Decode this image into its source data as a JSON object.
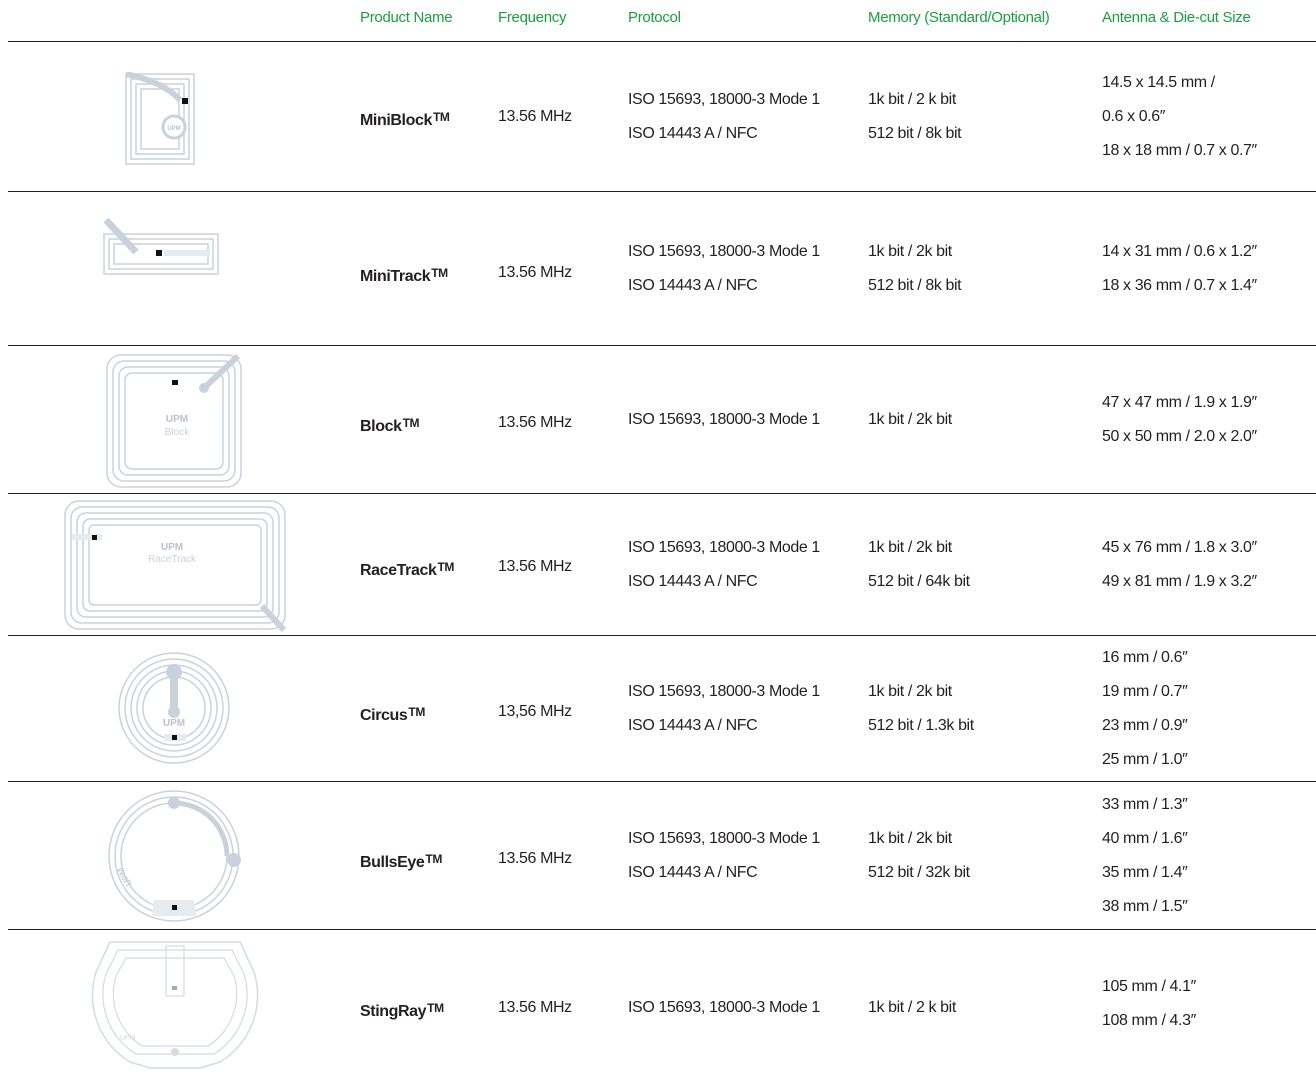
{
  "headers": {
    "product_name": "Product Name",
    "frequency": "Frequency",
    "protocol": "Protocol",
    "memory": "Memory (Standard/Optional)",
    "antenna": "Antenna & Die-cut Size"
  },
  "colors": {
    "header_text": "#1a9e3f",
    "rule": "#231f20",
    "antenna": "#c9d2da"
  },
  "rows": [
    {
      "name": "MiniBlock",
      "tm": "TM",
      "frequency": "13.56 MHz",
      "protocol": [
        "ISO 15693, 18000-3 Mode 1",
        "ISO 14443 A / NFC"
      ],
      "memory": [
        "1k bit / 2 k bit",
        "512 bit / 8k bit"
      ],
      "antenna": [
        "14.5 x 14.5 mm /",
        "0.6 x 0.6″",
        "18 x 18 mm / 0.7 x 0.7″"
      ],
      "image_logo": "UPM"
    },
    {
      "name": "MiniTrack",
      "tm": "TM",
      "frequency": "13.56 MHz",
      "protocol": [
        "ISO 15693, 18000-3 Mode 1",
        "ISO 14443 A / NFC"
      ],
      "memory": [
        "1k bit / 2k bit",
        "512 bit / 8k bit"
      ],
      "antenna": [
        "14 x 31 mm / 0.6 x 1.2″",
        "18 x 36 mm / 0.7 x 1.4″"
      ],
      "image_logo": ""
    },
    {
      "name": "Block",
      "tm": "TM",
      "frequency": "13.56 MHz",
      "protocol": [
        "ISO 15693, 18000-3 Mode 1"
      ],
      "memory": [
        "1k bit / 2k bit"
      ],
      "antenna": [
        "47 x 47 mm / 1.9 x 1.9″",
        "50 x 50 mm / 2.0 x 2.0″"
      ],
      "image_logo": "UPM",
      "image_caption": "Block"
    },
    {
      "name": "RaceTrack",
      "tm": "TM",
      "frequency": "13.56 MHz",
      "protocol": [
        "ISO 15693, 18000-3 Mode 1",
        "ISO 14443 A / NFC"
      ],
      "memory": [
        "1k bit / 2k bit",
        "512 bit / 64k bit"
      ],
      "antenna": [
        "45 x 76 mm / 1.8 x 3.0″",
        "49 x 81 mm / 1.9 x 3.2″"
      ],
      "image_logo": "UPM",
      "image_caption": "RaceTrack"
    },
    {
      "name": "Circus",
      "tm": "TM",
      "frequency": "13,56 MHz",
      "protocol": [
        "ISO 15693, 18000-3 Mode 1",
        "ISO 14443 A / NFC"
      ],
      "memory": [
        "1k bit / 2k bit",
        "512 bit / 1.3k bit"
      ],
      "antenna": [
        "16 mm / 0.6″",
        "19 mm / 0.7″",
        "23 mm / 0.9″",
        "25 mm / 1.0″"
      ],
      "image_logo": "UPM"
    },
    {
      "name": "BullsEye",
      "tm": "TM",
      "frequency": "13.56 MHz",
      "protocol": [
        "ISO 15693, 18000-3 Mode 1",
        "ISO 14443 A / NFC"
      ],
      "memory": [
        "1k bit / 2k bit",
        "512 bit / 32k bit"
      ],
      "antenna": [
        "33 mm / 1.3″",
        "40 mm / 1.6″",
        "35 mm / 1.4″",
        "38 mm / 1.5″"
      ],
      "image_logo": "UPM"
    },
    {
      "name": "StingRay",
      "tm": "TM",
      "frequency": "13.56 MHz",
      "protocol": [
        "ISO 15693, 18000-3 Mode 1"
      ],
      "memory": [
        "1k bit / 2 k bit"
      ],
      "antenna": [
        "105 mm / 4.1″",
        "108 mm / 4.3″"
      ],
      "image_logo": "UPM"
    }
  ]
}
